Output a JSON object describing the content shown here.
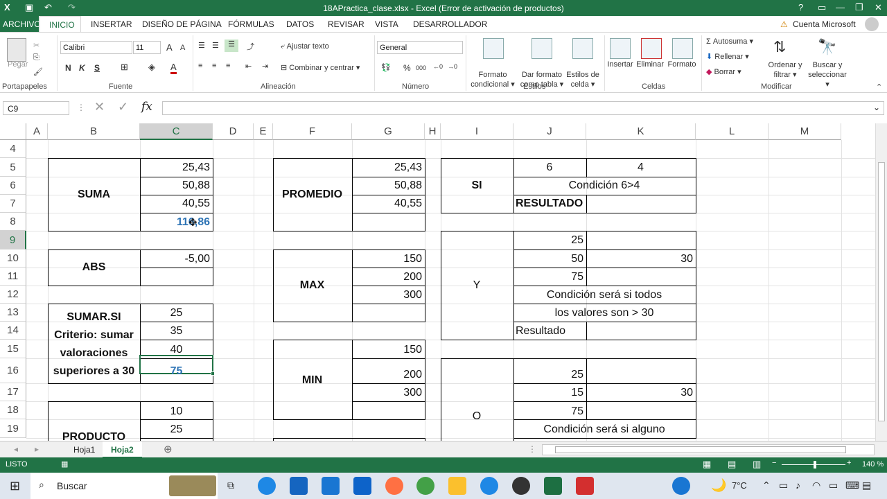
{
  "title_bar": {
    "title": "18APractica_clase.xlsx - Excel (Error de activación de productos)",
    "help": "?"
  },
  "tabs": [
    "ARCHIVO",
    "INICIO",
    "INSERTAR",
    "DISEÑO DE PÁGINA",
    "FÓRMULAS",
    "DATOS",
    "REVISAR",
    "VISTA",
    "DESARROLLADOR"
  ],
  "account": "Cuenta Microsoft",
  "ribbon": {
    "clipboard": {
      "paste": "Pegar",
      "group": "Portapapeles"
    },
    "font": {
      "name": "Calibri",
      "size": "11",
      "bold": "N",
      "italic": "K",
      "underline": "S",
      "group": "Fuente"
    },
    "alignment": {
      "wrap": "Ajustar texto",
      "merge": "Combinar y centrar",
      "group": "Alineación"
    },
    "number": {
      "format": "General",
      "percent": "%",
      "thousands": "000",
      "group": "Número"
    },
    "styles": {
      "conditional": [
        "Formato",
        "condicional"
      ],
      "table": [
        "Dar formato",
        "como tabla"
      ],
      "cell": [
        "Estilos de",
        "celda"
      ],
      "group": "Estilos"
    },
    "cells": {
      "insert": "Insertar",
      "delete": "Eliminar",
      "format": "Formato",
      "group": "Celdas"
    },
    "editing": {
      "autosum": "Autosuma",
      "fill": "Rellenar",
      "clear": "Borrar",
      "sort": [
        "Ordenar y",
        "filtrar"
      ],
      "find": [
        "Buscar y",
        "seleccionar"
      ],
      "group": "Modificar"
    }
  },
  "formula_bar": {
    "name_box": "C9",
    "fx": "fx",
    "content": ""
  },
  "columns": [
    "A",
    "B",
    "C",
    "D",
    "E",
    "F",
    "G",
    "H",
    "I",
    "J",
    "K",
    "L",
    "M"
  ],
  "rows": [
    "4",
    "5",
    "6",
    "7",
    "8",
    "9",
    "10",
    "11",
    "12",
    "13",
    "14",
    "15",
    "16",
    "17",
    "18",
    "19"
  ],
  "cells": {
    "suma_label": "SUMA",
    "c5": "25,43",
    "c6": "50,88",
    "c7": "40,55",
    "c8": "116,86",
    "abs_label": "ABS",
    "c10": "-5,00",
    "sumarsi_label": [
      "SUMAR.SI",
      "Criterio: sumar",
      "valoraciones",
      "superiores a 30"
    ],
    "c13": "25",
    "c14": "35",
    "c15": "40",
    "c16": "75",
    "producto_label": "PRODUCTO",
    "c18": "10",
    "c19": "25",
    "promedio_label": "PROMEDIO",
    "g5": "25,43",
    "g6": "50,88",
    "g7": "40,55",
    "max_label": "MAX",
    "g10": "150",
    "g11": "200",
    "g12": "300",
    "min_label": "MIN",
    "g15": "150",
    "g16": "200",
    "g17": "300",
    "si_label": "SI",
    "j5": "6",
    "k5": "4",
    "j6": "Condición 6>4",
    "j7": "RESULTADO",
    "y_label": "Y",
    "j9": "25",
    "j10": "50",
    "k10": "30",
    "j11": "75",
    "j12": "Condición será si todos",
    "j13": "los valores son > 30",
    "j14": "Resultado",
    "o_label": "O",
    "j16": "25",
    "j17": "15",
    "k17": "30",
    "j18": "75",
    "j19": "Condición será si alguno"
  },
  "sheets": [
    "Hoja1",
    "Hoja2"
  ],
  "status": {
    "ready": "LISTO",
    "zoom": "140 %"
  },
  "taskbar": {
    "search": "Buscar",
    "temp": "7°C"
  }
}
